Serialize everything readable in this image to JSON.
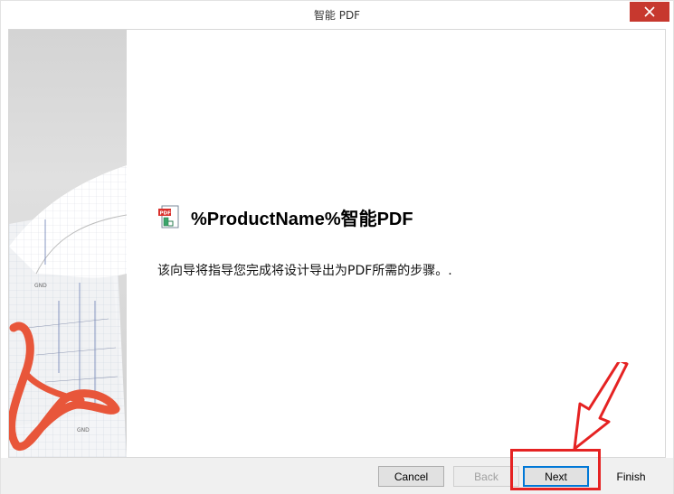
{
  "window": {
    "title": "智能 PDF"
  },
  "icons": {
    "close": "close-icon",
    "pdf": "pdf-document-icon"
  },
  "main": {
    "heading": "%ProductName%智能PDF",
    "description": "该向导将指导您完成将设计导出为PDF所需的步骤。."
  },
  "side_art": {
    "labels": [
      "GND",
      "GND"
    ]
  },
  "footer": {
    "cancel": "Cancel",
    "back": "Back",
    "next": "Next",
    "finish": "Finish"
  },
  "colors": {
    "close_red": "#c7382e",
    "annotation_red": "#e52222",
    "accent_blue": "#0078d7"
  }
}
